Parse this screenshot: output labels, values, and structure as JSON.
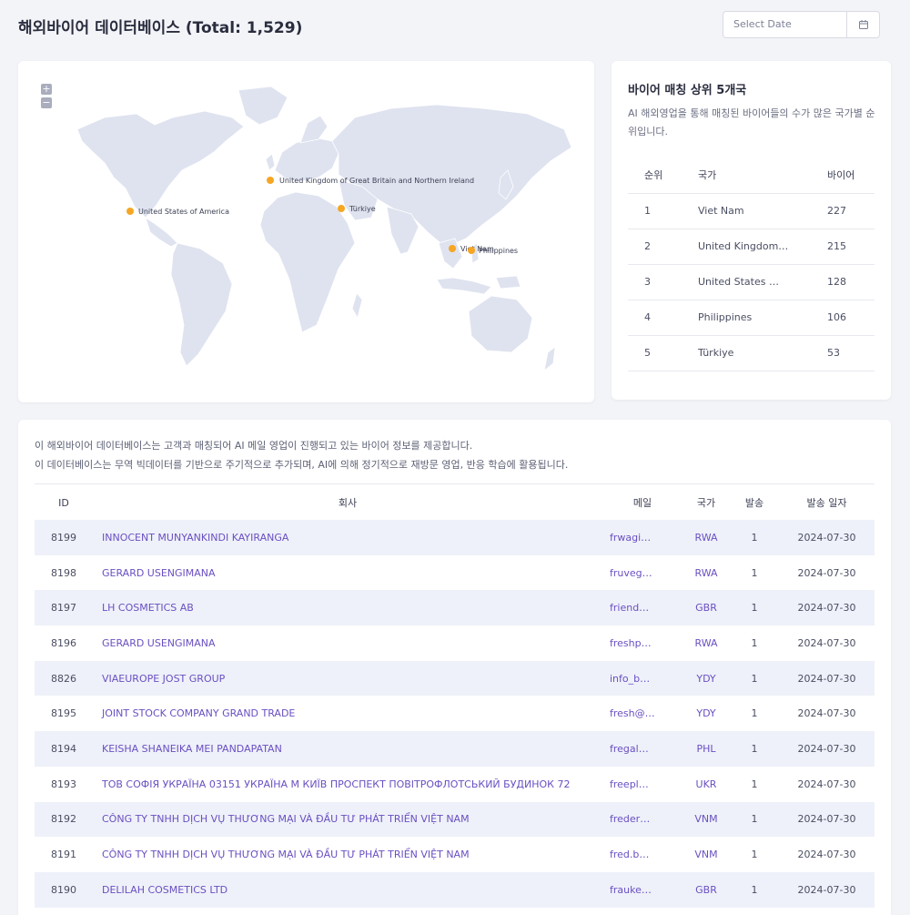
{
  "header": {
    "title": "해외바이어 데이터베이스 (Total: 1,529)",
    "date_placeholder": "Select Date",
    "calendar_icon": "calendar-icon"
  },
  "map": {
    "zoom_in_label": "+",
    "zoom_out_label": "−",
    "marker_color": "#f5a623",
    "land_color": "#dfe3ef",
    "markers": [
      {
        "label": "United Kingdom of Great Britain and Northern Ireland"
      },
      {
        "label": "United States of America"
      },
      {
        "label": "Türkiye"
      },
      {
        "label": "Viet Nam"
      },
      {
        "label": "Philippines"
      }
    ]
  },
  "top_buyers": {
    "title": "바이어 매칭 상위 5개국",
    "description": "AI 해외영업을 통해 매칭된 바이어들의 수가 많은 국가별 순위입니다.",
    "columns": {
      "rank": "순위",
      "country": "국가",
      "buyers": "바이어"
    },
    "rows": [
      {
        "rank": "1",
        "country": "Viet Nam",
        "buyers": "227"
      },
      {
        "rank": "2",
        "country": "United Kingdom…",
        "buyers": "215"
      },
      {
        "rank": "3",
        "country": "United States …",
        "buyers": "128"
      },
      {
        "rank": "4",
        "country": "Philippines",
        "buyers": "106"
      },
      {
        "rank": "5",
        "country": "Türkiye",
        "buyers": "53"
      }
    ]
  },
  "database": {
    "description_line1": "이 해외바이어 데이터베이스는 고객과 매칭되어 AI 메일 영업이 진행되고 있는 바이어 정보를 제공합니다.",
    "description_line2": "이 데이터베이스는 무역 빅데이터를 기반으로 주기적으로 추가되며, AI에 의해 정기적으로 재방문 영업, 반응 학습에 활용됩니다.",
    "columns": {
      "id": "ID",
      "company": "회사",
      "email": "메일",
      "country": "국가",
      "sent": "발송",
      "date": "발송 일자"
    },
    "rows": [
      {
        "id": "8199",
        "company": "INNOCENT MUNYANKINDI KAYIRANGA",
        "email": "frwagi…",
        "country": "RWA",
        "sent": "1",
        "date": "2024-07-30"
      },
      {
        "id": "8198",
        "company": "GERARD USENGIMANA",
        "email": "fruveg…",
        "country": "RWA",
        "sent": "1",
        "date": "2024-07-30"
      },
      {
        "id": "8197",
        "company": "LH COSMETICS AB",
        "email": "friend…",
        "country": "GBR",
        "sent": "1",
        "date": "2024-07-30"
      },
      {
        "id": "8196",
        "company": "GERARD USENGIMANA",
        "email": "freshp…",
        "country": "RWA",
        "sent": "1",
        "date": "2024-07-30"
      },
      {
        "id": "8826",
        "company": "VIAEUROPE JOST GROUP",
        "email": "info_b…",
        "country": "YDY",
        "sent": "1",
        "date": "2024-07-30"
      },
      {
        "id": "8195",
        "company": "JOINT STOCK COMPANY GRAND TRADE",
        "email": "fresh@…",
        "country": "YDY",
        "sent": "1",
        "date": "2024-07-30"
      },
      {
        "id": "8194",
        "company": "KEISHA SHANEIKA MEI PANDAPATAN",
        "email": "fregal…",
        "country": "PHL",
        "sent": "1",
        "date": "2024-07-30"
      },
      {
        "id": "8193",
        "company": "ТОВ СОФІЯ УКРАЇНА 03151 УКРАЇНА М КИЇВ ПРОСПЕКТ ПОВІТРОФЛОТСЬКИЙ БУДИНОК 72",
        "email": "freepl…",
        "country": "UKR",
        "sent": "1",
        "date": "2024-07-30"
      },
      {
        "id": "8192",
        "company": "CÔNG TY TNHH DỊCH VỤ THƯƠNG MẠI VÀ ĐẦU TƯ PHÁT TRIỂN VIỆT NAM",
        "email": "freder…",
        "country": "VNM",
        "sent": "1",
        "date": "2024-07-30"
      },
      {
        "id": "8191",
        "company": "CÔNG TY TNHH DỊCH VỤ THƯƠNG MẠI VÀ ĐẦU TƯ PHÁT TRIỂN VIỆT NAM",
        "email": "fred.b…",
        "country": "VNM",
        "sent": "1",
        "date": "2024-07-30"
      },
      {
        "id": "8190",
        "company": "DELILAH COSMETICS LTD",
        "email": "frauke…",
        "country": "GBR",
        "sent": "1",
        "date": "2024-07-30"
      }
    ]
  }
}
